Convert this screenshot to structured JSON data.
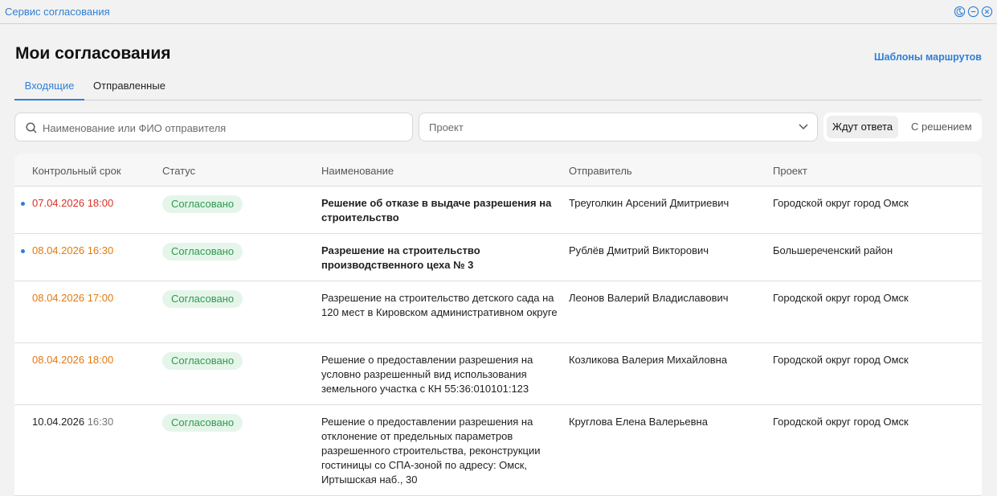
{
  "window": {
    "title": "Сервис согласования",
    "controls": [
      "moon-icon",
      "minimize-icon",
      "close-icon"
    ]
  },
  "header": {
    "title": "Мои согласования",
    "templates_link": "Шаблоны маршрутов"
  },
  "tabs": [
    {
      "label": "Входящие",
      "active": true
    },
    {
      "label": "Отправленные",
      "active": false
    }
  ],
  "filters": {
    "search_placeholder": "Наименование или ФИО отправителя",
    "project_placeholder": "Проект",
    "segment": [
      {
        "label": "Ждут ответа",
        "selected": true
      },
      {
        "label": "С решением",
        "selected": false
      }
    ]
  },
  "table": {
    "headers": {
      "deadline": "Контрольный срок",
      "status": "Статус",
      "name": "Наименование",
      "sender": "Отправитель",
      "project": "Проект"
    },
    "rows": [
      {
        "unread": true,
        "date": "07.04.2026",
        "time": "18:00",
        "urgency": "overdue",
        "status": "Согласовано",
        "name": "Решение об отказе в выдаче разрешения на строительство",
        "sender": "Треуголкин Арсений Дмитриевич",
        "project": "Городской округ город Омск"
      },
      {
        "unread": true,
        "date": "08.04.2026",
        "time": "16:30",
        "urgency": "soon",
        "status": "Согласовано",
        "name": "Разрешение на строительство производственного цеха № 3",
        "sender": "Рублёв Дмитрий Викторович",
        "project": "Большереченский район"
      },
      {
        "unread": false,
        "date": "08.04.2026",
        "time": "17:00",
        "urgency": "soon",
        "status": "Согласовано",
        "name": "Разрешение на строительство детского сада на 120 мест в Кировском административном округе",
        "sender": "Леонов Валерий Владиславович",
        "project": "Городской округ город Омск"
      },
      {
        "unread": false,
        "date": "08.04.2026",
        "time": "18:00",
        "urgency": "soon",
        "status": "Согласовано",
        "name": "Решение о предоставлении разрешения на условно разрешенный вид использования земельного участка с КН 55:36:010101:123",
        "sender": "Козликова Валерия Михайловна",
        "project": "Городской округ город Омск"
      },
      {
        "unread": false,
        "date": "10.04.2026",
        "time": "16:30",
        "urgency": "normal",
        "status": "Согласовано",
        "name": "Решение о предоставлении разрешения на отклонение от предельных параметров разрешенного строительства, реконструкции гостиницы со СПА-зоной по адресу: Омск, Иртышская наб., 30",
        "sender": "Круглова Елена Валерьевна",
        "project": "Городской округ город Омск"
      }
    ]
  },
  "colors": {
    "accent": "#2f7fd6",
    "overdue": "#d93025",
    "soon": "#e07a10",
    "status_bg": "#e5f5ea",
    "status_text": "#2e9a4e"
  }
}
